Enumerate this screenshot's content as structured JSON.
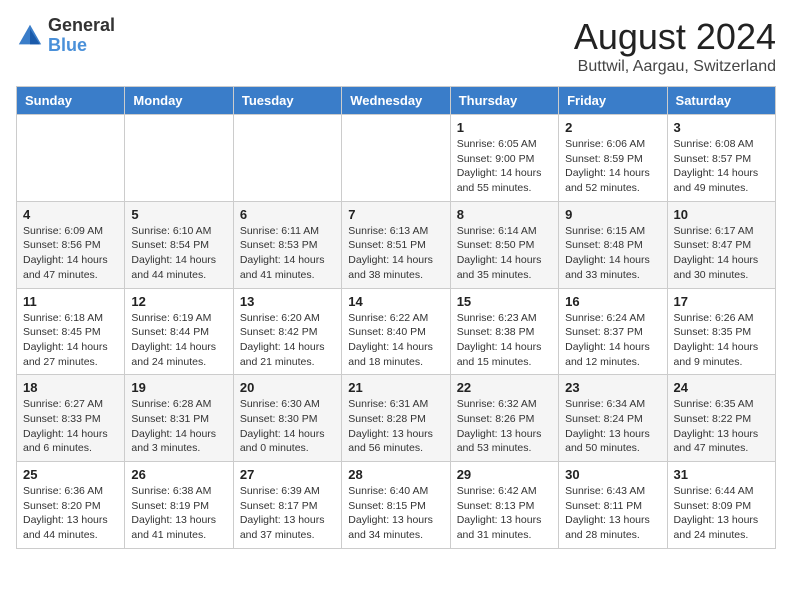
{
  "logo": {
    "text_general": "General",
    "text_blue": "Blue"
  },
  "header": {
    "month": "August 2024",
    "location": "Buttwil, Aargau, Switzerland"
  },
  "weekdays": [
    "Sunday",
    "Monday",
    "Tuesday",
    "Wednesday",
    "Thursday",
    "Friday",
    "Saturday"
  ],
  "weeks": [
    [
      {
        "day": "",
        "info": ""
      },
      {
        "day": "",
        "info": ""
      },
      {
        "day": "",
        "info": ""
      },
      {
        "day": "",
        "info": ""
      },
      {
        "day": "1",
        "info": "Sunrise: 6:05 AM\nSunset: 9:00 PM\nDaylight: 14 hours\nand 55 minutes."
      },
      {
        "day": "2",
        "info": "Sunrise: 6:06 AM\nSunset: 8:59 PM\nDaylight: 14 hours\nand 52 minutes."
      },
      {
        "day": "3",
        "info": "Sunrise: 6:08 AM\nSunset: 8:57 PM\nDaylight: 14 hours\nand 49 minutes."
      }
    ],
    [
      {
        "day": "4",
        "info": "Sunrise: 6:09 AM\nSunset: 8:56 PM\nDaylight: 14 hours\nand 47 minutes."
      },
      {
        "day": "5",
        "info": "Sunrise: 6:10 AM\nSunset: 8:54 PM\nDaylight: 14 hours\nand 44 minutes."
      },
      {
        "day": "6",
        "info": "Sunrise: 6:11 AM\nSunset: 8:53 PM\nDaylight: 14 hours\nand 41 minutes."
      },
      {
        "day": "7",
        "info": "Sunrise: 6:13 AM\nSunset: 8:51 PM\nDaylight: 14 hours\nand 38 minutes."
      },
      {
        "day": "8",
        "info": "Sunrise: 6:14 AM\nSunset: 8:50 PM\nDaylight: 14 hours\nand 35 minutes."
      },
      {
        "day": "9",
        "info": "Sunrise: 6:15 AM\nSunset: 8:48 PM\nDaylight: 14 hours\nand 33 minutes."
      },
      {
        "day": "10",
        "info": "Sunrise: 6:17 AM\nSunset: 8:47 PM\nDaylight: 14 hours\nand 30 minutes."
      }
    ],
    [
      {
        "day": "11",
        "info": "Sunrise: 6:18 AM\nSunset: 8:45 PM\nDaylight: 14 hours\nand 27 minutes."
      },
      {
        "day": "12",
        "info": "Sunrise: 6:19 AM\nSunset: 8:44 PM\nDaylight: 14 hours\nand 24 minutes."
      },
      {
        "day": "13",
        "info": "Sunrise: 6:20 AM\nSunset: 8:42 PM\nDaylight: 14 hours\nand 21 minutes."
      },
      {
        "day": "14",
        "info": "Sunrise: 6:22 AM\nSunset: 8:40 PM\nDaylight: 14 hours\nand 18 minutes."
      },
      {
        "day": "15",
        "info": "Sunrise: 6:23 AM\nSunset: 8:38 PM\nDaylight: 14 hours\nand 15 minutes."
      },
      {
        "day": "16",
        "info": "Sunrise: 6:24 AM\nSunset: 8:37 PM\nDaylight: 14 hours\nand 12 minutes."
      },
      {
        "day": "17",
        "info": "Sunrise: 6:26 AM\nSunset: 8:35 PM\nDaylight: 14 hours\nand 9 minutes."
      }
    ],
    [
      {
        "day": "18",
        "info": "Sunrise: 6:27 AM\nSunset: 8:33 PM\nDaylight: 14 hours\nand 6 minutes."
      },
      {
        "day": "19",
        "info": "Sunrise: 6:28 AM\nSunset: 8:31 PM\nDaylight: 14 hours\nand 3 minutes."
      },
      {
        "day": "20",
        "info": "Sunrise: 6:30 AM\nSunset: 8:30 PM\nDaylight: 14 hours\nand 0 minutes."
      },
      {
        "day": "21",
        "info": "Sunrise: 6:31 AM\nSunset: 8:28 PM\nDaylight: 13 hours\nand 56 minutes."
      },
      {
        "day": "22",
        "info": "Sunrise: 6:32 AM\nSunset: 8:26 PM\nDaylight: 13 hours\nand 53 minutes."
      },
      {
        "day": "23",
        "info": "Sunrise: 6:34 AM\nSunset: 8:24 PM\nDaylight: 13 hours\nand 50 minutes."
      },
      {
        "day": "24",
        "info": "Sunrise: 6:35 AM\nSunset: 8:22 PM\nDaylight: 13 hours\nand 47 minutes."
      }
    ],
    [
      {
        "day": "25",
        "info": "Sunrise: 6:36 AM\nSunset: 8:20 PM\nDaylight: 13 hours\nand 44 minutes."
      },
      {
        "day": "26",
        "info": "Sunrise: 6:38 AM\nSunset: 8:19 PM\nDaylight: 13 hours\nand 41 minutes."
      },
      {
        "day": "27",
        "info": "Sunrise: 6:39 AM\nSunset: 8:17 PM\nDaylight: 13 hours\nand 37 minutes."
      },
      {
        "day": "28",
        "info": "Sunrise: 6:40 AM\nSunset: 8:15 PM\nDaylight: 13 hours\nand 34 minutes."
      },
      {
        "day": "29",
        "info": "Sunrise: 6:42 AM\nSunset: 8:13 PM\nDaylight: 13 hours\nand 31 minutes."
      },
      {
        "day": "30",
        "info": "Sunrise: 6:43 AM\nSunset: 8:11 PM\nDaylight: 13 hours\nand 28 minutes."
      },
      {
        "day": "31",
        "info": "Sunrise: 6:44 AM\nSunset: 8:09 PM\nDaylight: 13 hours\nand 24 minutes."
      }
    ]
  ]
}
